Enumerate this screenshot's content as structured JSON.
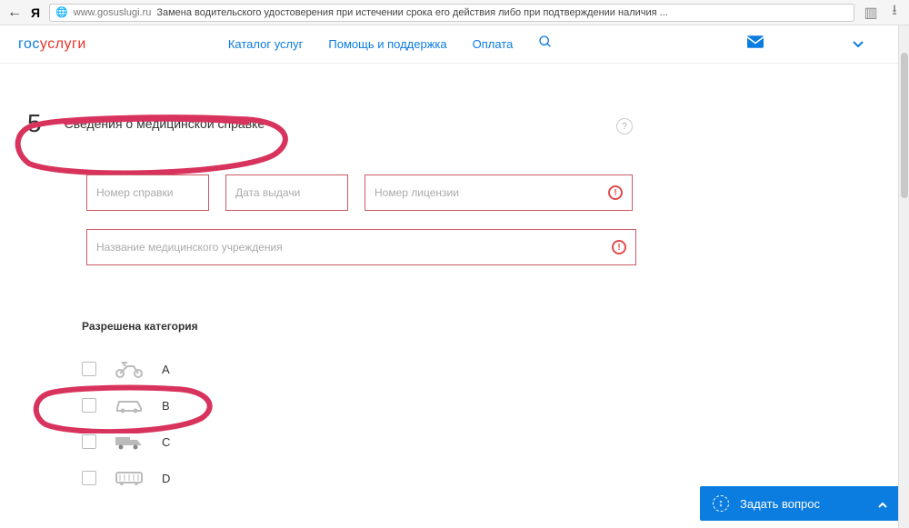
{
  "browser": {
    "domain": "www.gosuslugi.ru",
    "page_title": "Замена водительского удостоверения при истечении срока его действия либо при подтверждении наличия ..."
  },
  "header": {
    "logo_part1": "гос",
    "logo_part2": "услуги",
    "nav": {
      "catalog": "Каталог услуг",
      "help": "Помощь и поддержка",
      "payment": "Оплата"
    }
  },
  "step": {
    "number": "5",
    "title": "Сведения о медицинской справке"
  },
  "form": {
    "cert_number_placeholder": "Номер справки",
    "issue_date_placeholder": "Дата выдачи",
    "license_number_placeholder": "Номер лицензии",
    "institution_placeholder": "Название медицинского учреждения"
  },
  "categories": {
    "section_label": "Разрешена категория",
    "items": [
      {
        "icon": "motorcycle",
        "label": "A"
      },
      {
        "icon": "car",
        "label": "B"
      },
      {
        "icon": "truck",
        "label": "C"
      },
      {
        "icon": "bus",
        "label": "D"
      }
    ]
  },
  "ask_button": {
    "label": "Задать вопрос"
  },
  "colors": {
    "accent_blue": "#0b7ce0",
    "error_red": "#e14b4b",
    "border_error": "#cc5b63"
  }
}
